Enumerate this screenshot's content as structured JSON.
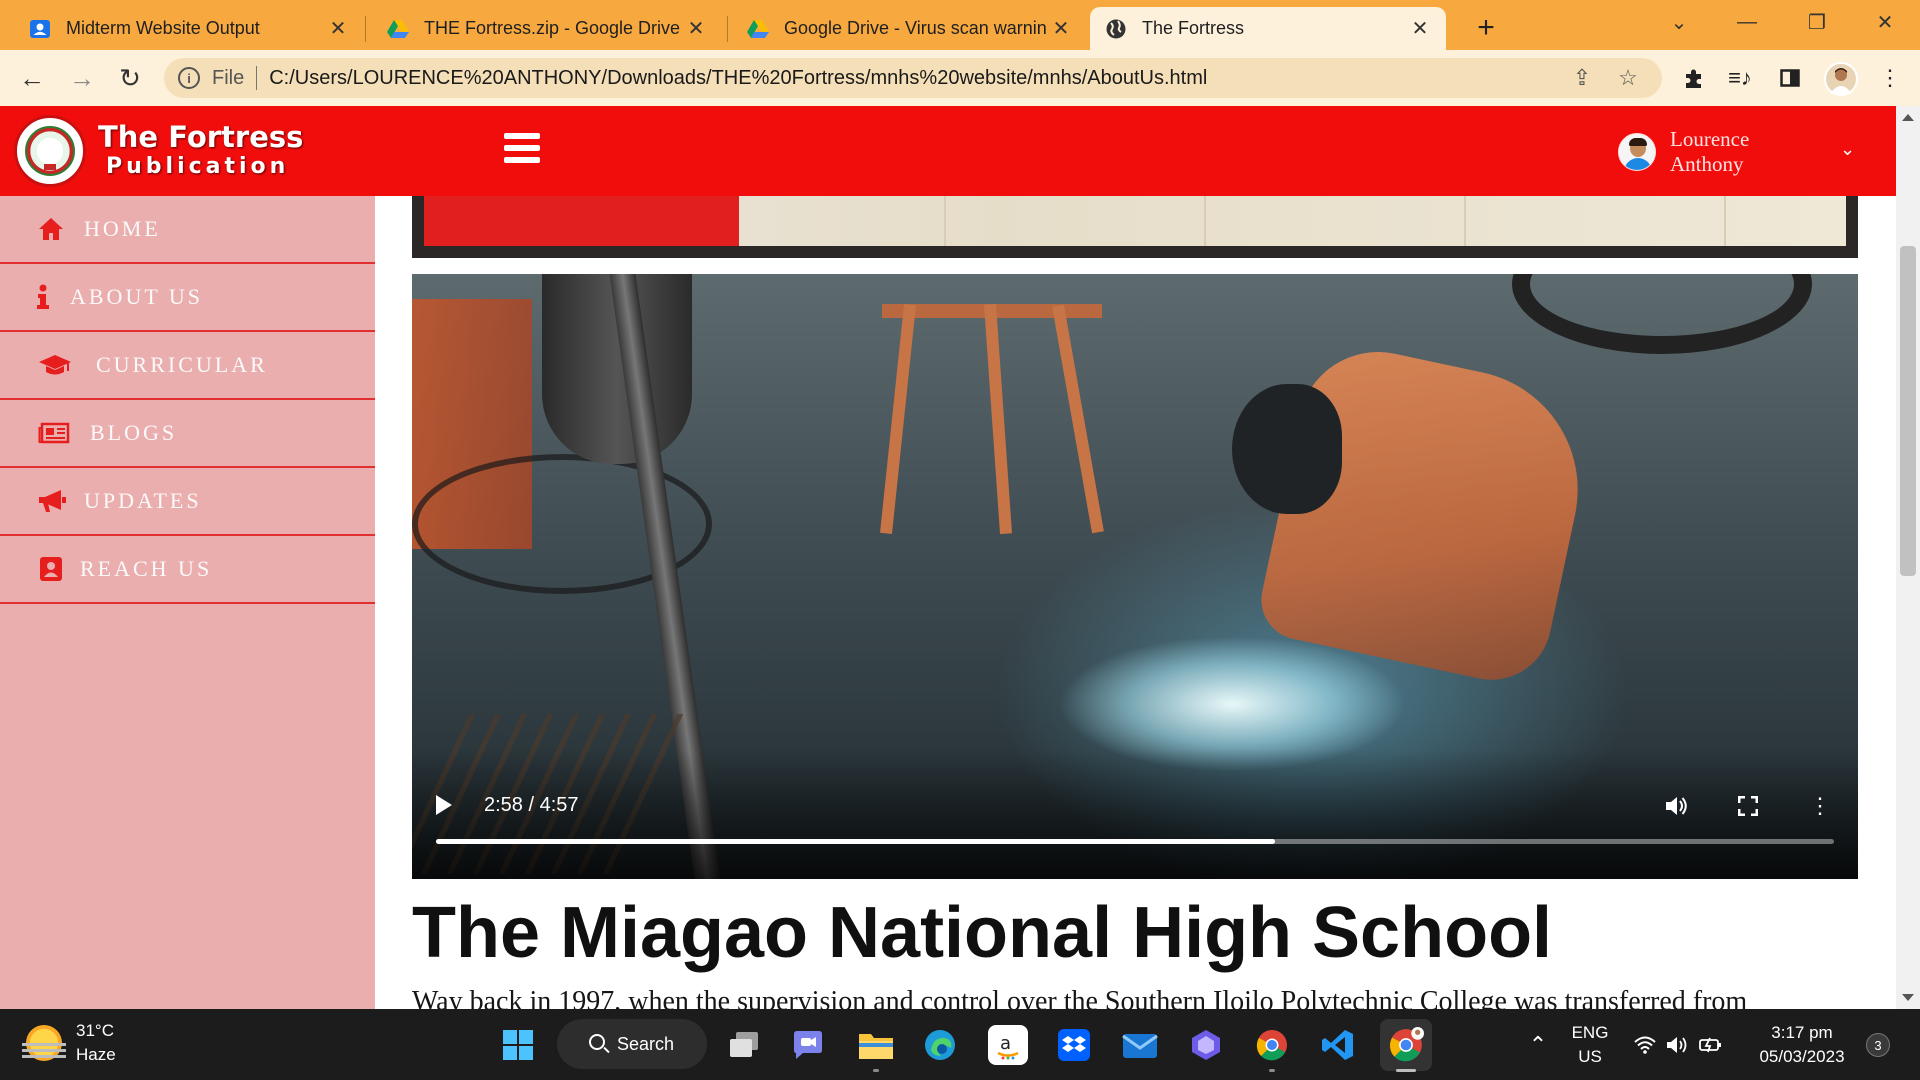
{
  "browser": {
    "tabs": [
      {
        "title": "Midterm Website Output",
        "icon": "user-card-icon",
        "active": false
      },
      {
        "title": "THE Fortress.zip - Google Drive",
        "icon": "google-drive-icon",
        "active": false
      },
      {
        "title": "Google Drive - Virus scan warnin",
        "icon": "google-drive-icon",
        "active": false
      },
      {
        "title": "The Fortress",
        "icon": "globe-icon",
        "active": true
      }
    ],
    "scheme": "File",
    "url": "C:/Users/LOURENCE%20ANTHONY/Downloads/THE%20Fortress/mnhs%20website/mnhs/AboutUs.html"
  },
  "site": {
    "brand_title": "The Fortress",
    "brand_subtitle": "Publication",
    "user_name": "Lourence Anthony",
    "nav": [
      {
        "label": "HOME",
        "icon": "home-icon"
      },
      {
        "label": "ABOUT US",
        "icon": "info-icon"
      },
      {
        "label": "CURRICULAR",
        "icon": "graduation-cap-icon"
      },
      {
        "label": "BLOGS",
        "icon": "newspaper-icon"
      },
      {
        "label": "UPDATES",
        "icon": "megaphone-icon"
      },
      {
        "label": "REACH US",
        "icon": "contact-card-icon"
      }
    ]
  },
  "video": {
    "time": "2:58 / 4:57",
    "progress": 0.6
  },
  "content": {
    "heading": "The Miagao National High School",
    "paragraph": "Way back in 1997, when the supervision and control over the Southern Iloilo Polytechnic College was transferred from"
  },
  "taskbar": {
    "temperature": "31°C",
    "condition": "Haze",
    "search_label": "Search",
    "lang_top": "ENG",
    "lang_bottom": "US",
    "time": "3:17 pm",
    "date": "05/03/2023",
    "notification_count": "3"
  },
  "colors": {
    "tabbar": "#f7a940",
    "header_red": "#f20d0d",
    "sidebar_pink": "#ebaeae",
    "sidebar_icon_red": "#e61e1e"
  }
}
